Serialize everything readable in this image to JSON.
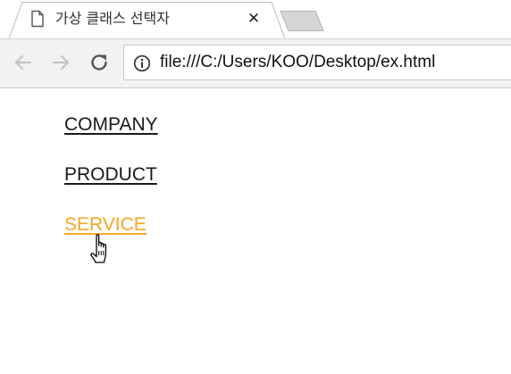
{
  "browser": {
    "tab": {
      "title": "가상 클래스 선택자",
      "close_glyph": "✕",
      "page_icon": "document-icon"
    },
    "toolbar": {
      "back_icon": "arrow-left-icon",
      "forward_icon": "arrow-right-icon",
      "reload_icon": "reload-icon",
      "info_icon": "info-icon"
    },
    "address_bar": {
      "url": "file:///C:/Users/KOO/Desktop/ex.html"
    }
  },
  "page": {
    "links": [
      {
        "label": "COMPANY",
        "state": "normal"
      },
      {
        "label": "PRODUCT",
        "state": "normal"
      },
      {
        "label": "SERVICE",
        "state": "hover"
      }
    ],
    "colors": {
      "link": "#1a1a1a",
      "link_hover": "#f5a623"
    },
    "cursor_icon": "hand-pointer-icon"
  }
}
